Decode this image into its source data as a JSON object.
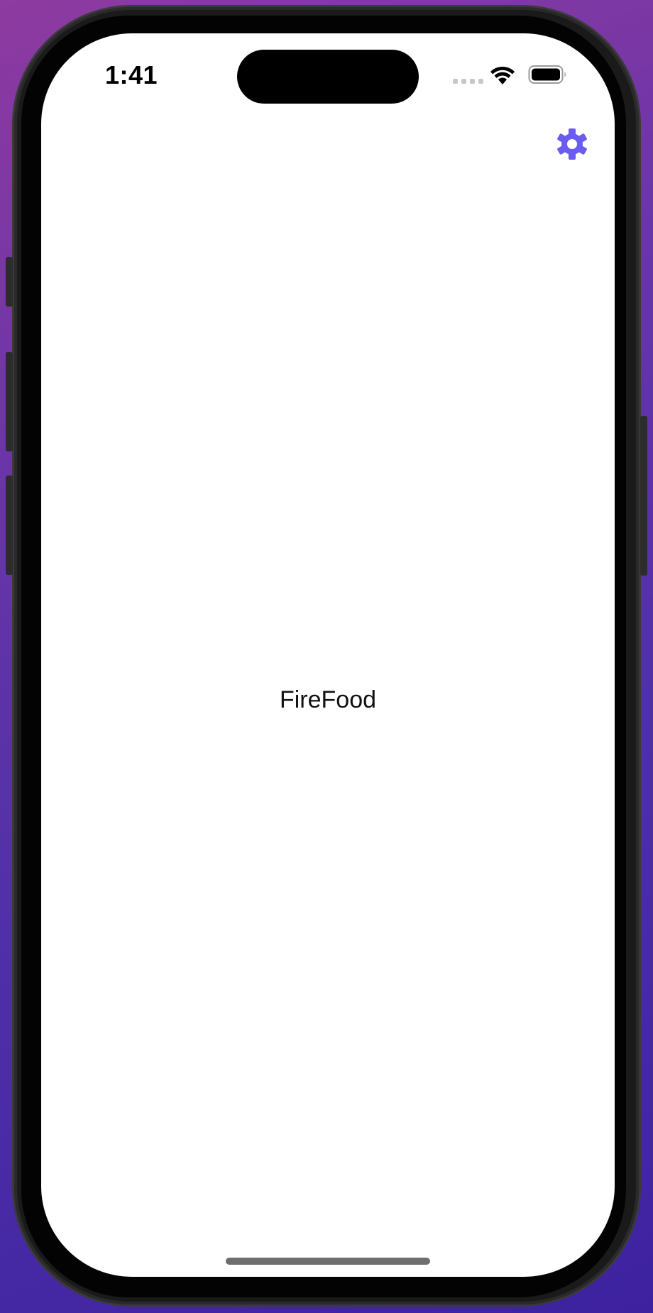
{
  "status_bar": {
    "time": "1:41",
    "wifi_icon": "wifi-icon",
    "battery_icon": "battery-icon"
  },
  "toolbar": {
    "settings_icon": "gear-icon",
    "accent_color": "#6a5cf0"
  },
  "main": {
    "title": "FireFood"
  }
}
